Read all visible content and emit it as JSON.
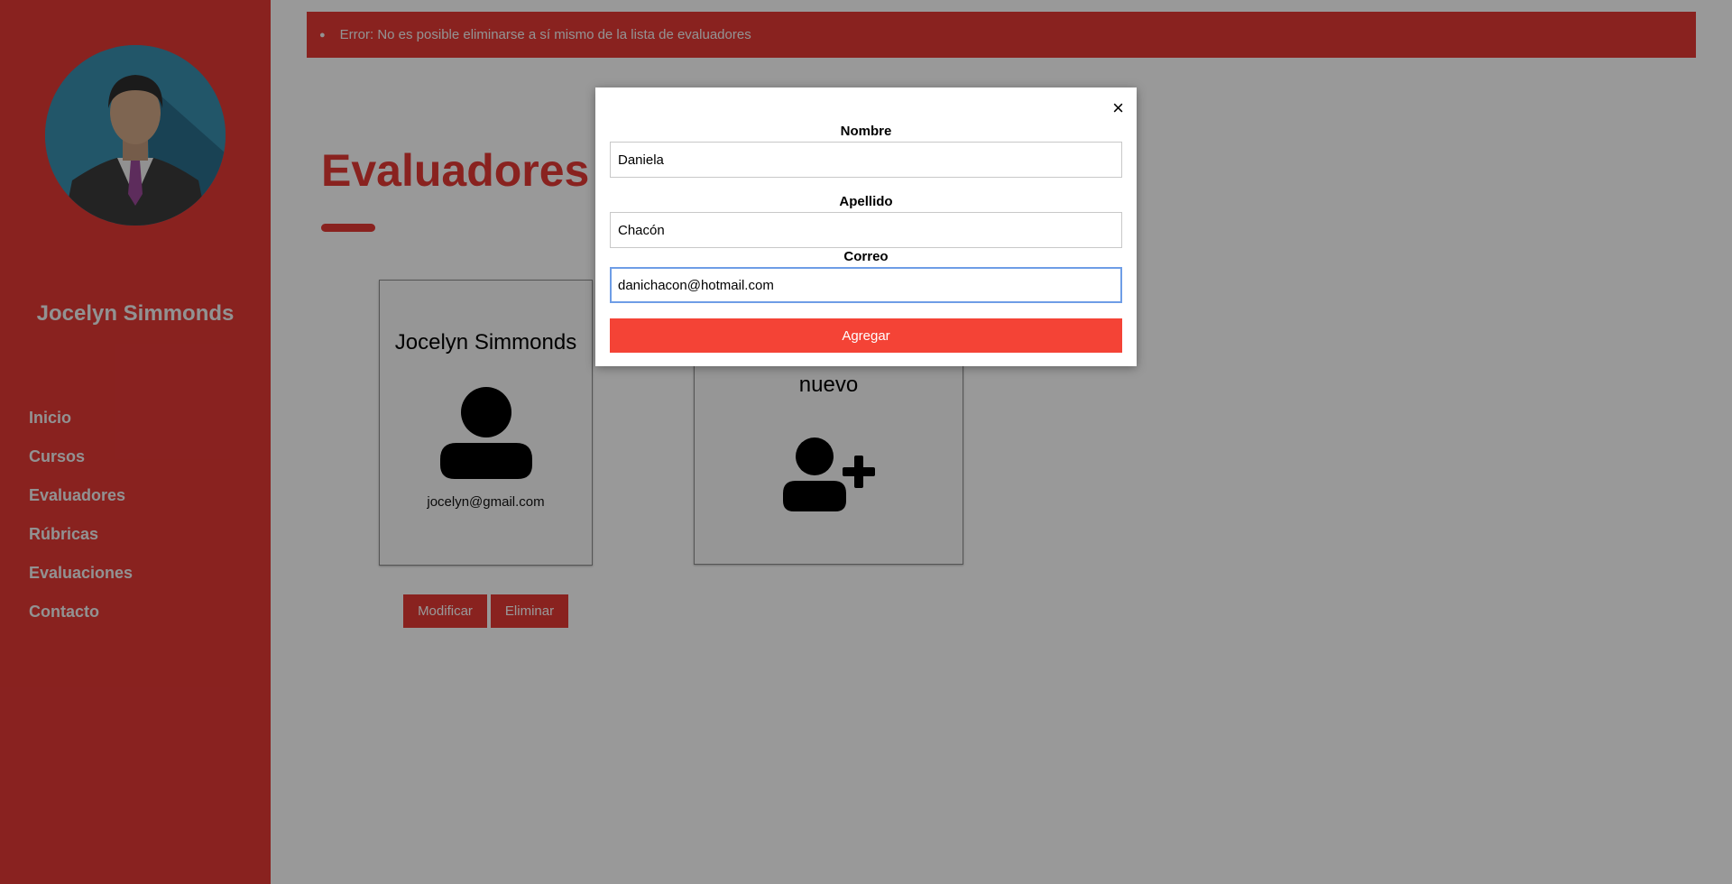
{
  "sidebar": {
    "user_name": "Jocelyn Simmonds",
    "items": [
      {
        "label": "Inicio"
      },
      {
        "label": "Cursos"
      },
      {
        "label": "Evaluadores"
      },
      {
        "label": "Rúbricas"
      },
      {
        "label": "Evaluaciones"
      },
      {
        "label": "Contacto"
      }
    ]
  },
  "alert": {
    "message": "Error: No es posible eliminarse a sí mismo de la lista de evaluadores"
  },
  "main": {
    "title": "Evaluadores",
    "evaluators": [
      {
        "name": "Jocelyn Simmonds",
        "email": "jocelyn@gmail.com"
      }
    ],
    "add_card_text": "nuevo",
    "modify_label": "Modificar",
    "delete_label": "Eliminar"
  },
  "modal": {
    "close_glyph": "×",
    "nombre_label": "Nombre",
    "nombre_value": "Daniela",
    "apellido_label": "Apellido",
    "apellido_value": "Chacón",
    "correo_label": "Correo",
    "correo_value": "danichacon@hotmail.com",
    "submit_label": "Agregar"
  },
  "icons": {
    "avatar": "businessman-avatar-icon",
    "person": "person-icon",
    "add_person": "person-plus-icon",
    "close": "close-icon"
  },
  "colors": {
    "primary": "#e53935",
    "modal_button": "#f44336",
    "focus_border": "#6e9de6"
  }
}
